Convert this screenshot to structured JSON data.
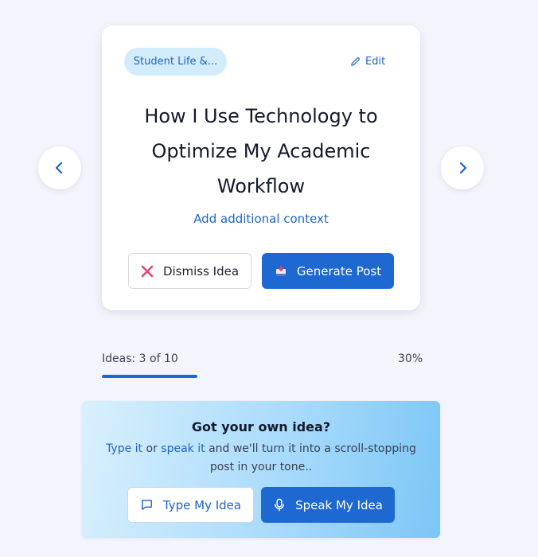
{
  "navigation": {
    "prev_icon": "chevron-left-icon",
    "next_icon": "chevron-right-icon"
  },
  "idea_card": {
    "category": "Student Life &...",
    "edit_label": "Edit",
    "title": "How I Use Technology to Optimize My Academic Workflow",
    "context_link": "Add additional context",
    "dismiss_label": "Dismiss Idea",
    "generate_label": "Generate Post"
  },
  "progress": {
    "label": "Ideas: 3 of 10",
    "percent_label": "30%",
    "fraction": 0.3
  },
  "own_idea": {
    "title": "Got your own idea?",
    "desc_type": "Type it",
    "desc_or": "or",
    "desc_speak": "speak it",
    "desc_rest": "and we'll turn it into a scroll-stopping post in your tone..",
    "type_label": "Type My Idea",
    "speak_label": "Speak My Idea"
  },
  "colors": {
    "accent": "#1e68d1",
    "link": "#1e64c8",
    "dismiss_icon": "#e0457b",
    "pill_bg": "#d2ecfb"
  }
}
